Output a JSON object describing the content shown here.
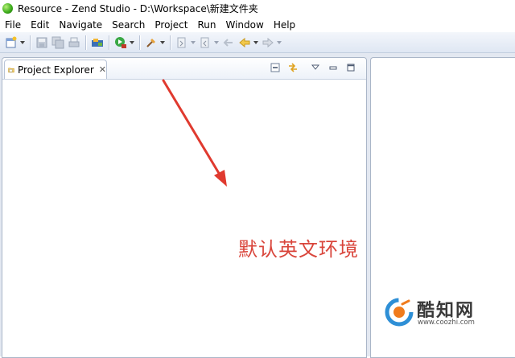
{
  "window": {
    "title": "Resource - Zend Studio - D:\\Workspace\\新建文件夹"
  },
  "menu": {
    "items": [
      "File",
      "Edit",
      "Navigate",
      "Search",
      "Project",
      "Run",
      "Window",
      "Help"
    ]
  },
  "toolbar": {
    "icons": [
      "new-wizard-icon",
      "save-icon",
      "save-all-icon",
      "print-icon",
      "open-type-icon",
      "run-icon",
      "external-tools-icon",
      "next-annotation-icon",
      "previous-annotation-icon",
      "back-icon",
      "forward-icon"
    ]
  },
  "explorer": {
    "tab_label": "Project Explorer",
    "close_glyph": "✕"
  },
  "annotation": {
    "text": "默认英文环境",
    "color": "#d9453b"
  },
  "watermark": {
    "title": "酷知网",
    "url": "www.coozhi.com"
  },
  "colors": {
    "toolbar_bg": "#dfe7f3",
    "workbench_bg": "#e3e8f1",
    "annotation_red": "#d9453b"
  }
}
